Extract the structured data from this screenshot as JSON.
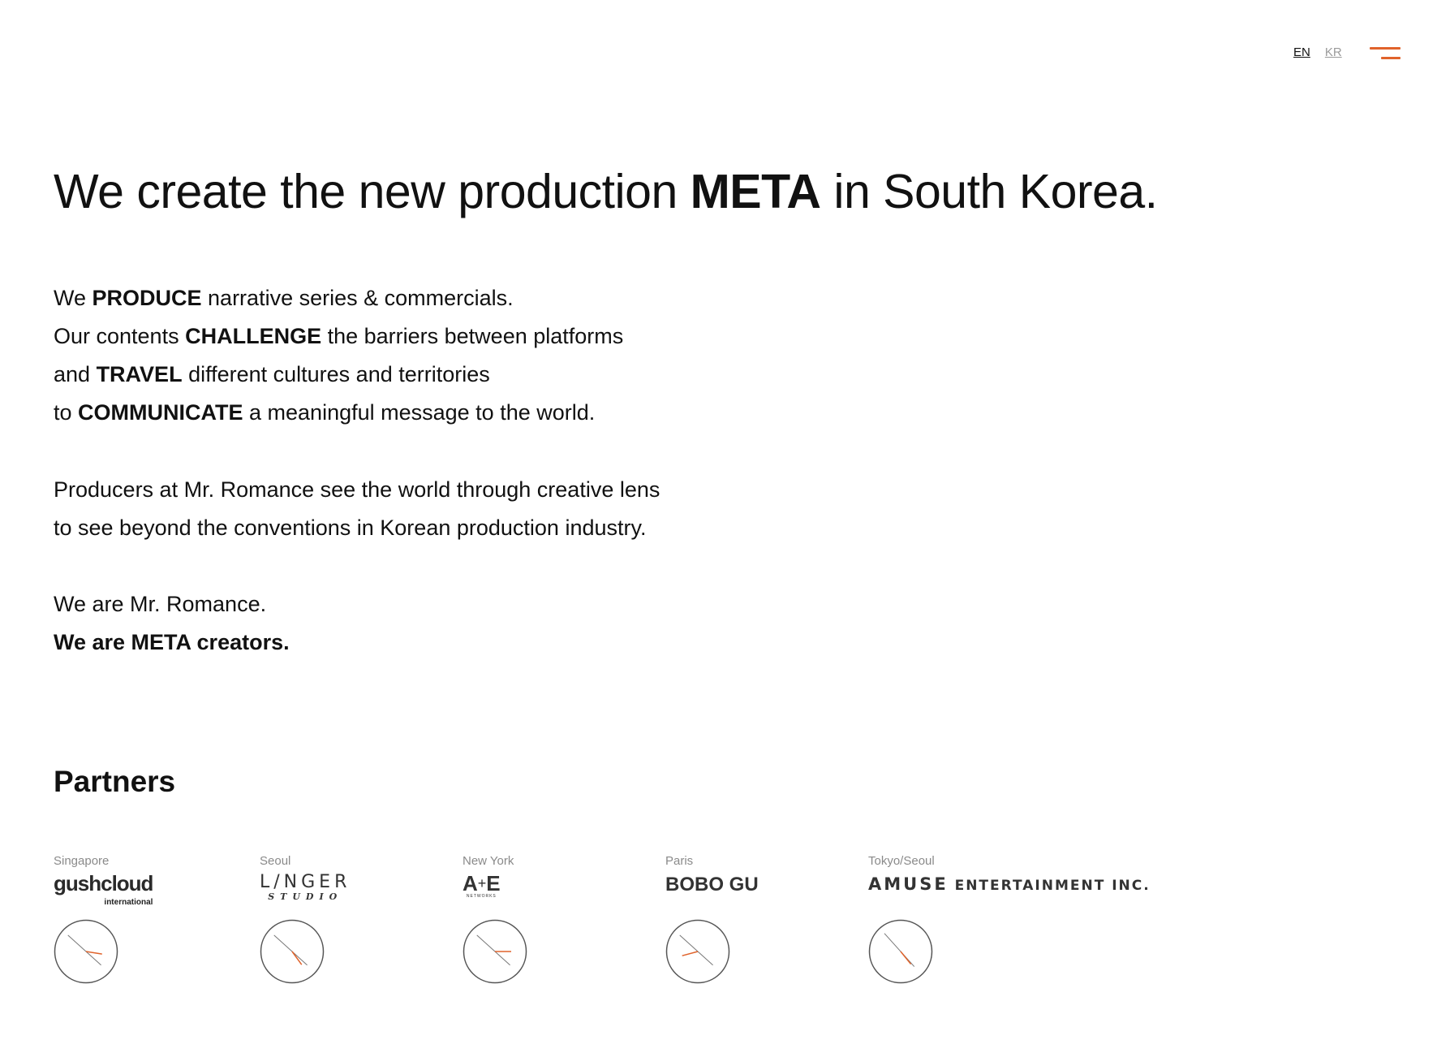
{
  "header": {
    "lang_en": "EN",
    "lang_kr": "KR",
    "menu_icon": "hamburger-menu-icon",
    "accent_color": "#e0632b"
  },
  "intro": {
    "headline": {
      "pre": "We create the new production ",
      "bold": "META",
      "post": " in South Korea."
    },
    "paragraph1": [
      {
        "pre": "We ",
        "bold": "PRODUCE",
        "post": " narrative series & commercials."
      },
      {
        "pre": "Our contents ",
        "bold": "CHALLENGE",
        "post": " the barriers between platforms"
      },
      {
        "pre": "and ",
        "bold": "TRAVEL",
        "post": " different cultures and territories"
      },
      {
        "pre": "to ",
        "bold": "COMMUNICATE",
        "post": " a meaningful message to the world."
      }
    ],
    "paragraph2": [
      "Producers at Mr. Romance see the world through creative lens",
      "to see beyond the conventions in Korean production industry."
    ],
    "paragraph3": {
      "line1": "We are Mr. Romance.",
      "line2": "We are META creators."
    }
  },
  "partners": {
    "title": "Partners",
    "items": [
      {
        "city": "Singapore",
        "logo_main": "gushcloud",
        "logo_sub": "international",
        "clock_icon": "clock-icon"
      },
      {
        "city": "Seoul",
        "logo_main": "L/NGER",
        "logo_sub": "STUDIO",
        "clock_icon": "clock-icon"
      },
      {
        "city": "New York",
        "logo_main": "A",
        "logo_plus": "+",
        "logo_main2": "E",
        "logo_sub": "NETWORKS",
        "clock_icon": "clock-icon"
      },
      {
        "city": "Paris",
        "logo_main": "BOBO GU",
        "clock_icon": "clock-icon"
      },
      {
        "city": "Tokyo/Seoul",
        "logo_main": "AMUSE",
        "logo_sub": " ENTERTAINMENT INC.",
        "clock_icon": "clock-icon"
      }
    ],
    "clock_times": [
      {
        "hour": 3.3,
        "minute": 52
      },
      {
        "hour": 4.8,
        "minute": 52
      },
      {
        "hour": 3.0,
        "minute": 52
      },
      {
        "hour": 8.5,
        "minute": 52
      },
      {
        "hour": 4.7,
        "minute": 53
      }
    ]
  }
}
